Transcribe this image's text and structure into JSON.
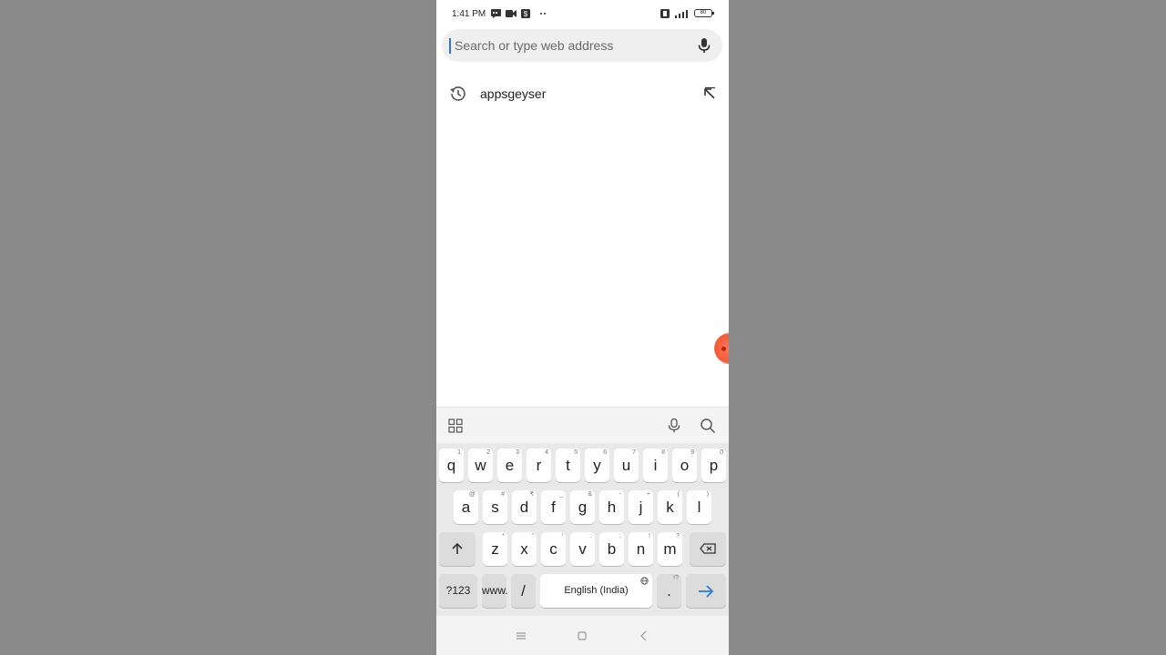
{
  "status_bar": {
    "time": "1:41 PM",
    "left_icons": [
      "message-icon",
      "video-icon",
      "app-icon",
      "more-dots-icon"
    ],
    "right_icons": [
      "vibrate-icon",
      "signal-icon"
    ],
    "battery": "80"
  },
  "search": {
    "placeholder": "Search or type web address",
    "voice_icon": "microphone-icon"
  },
  "suggestions": [
    {
      "text": "appsgeyser",
      "icon": "history-icon",
      "action_icon": "fill-arrow-icon"
    }
  ],
  "keyboard_toolbar": {
    "icons": [
      "grid-icon",
      "microphone-icon",
      "search-icon"
    ]
  },
  "keyboard": {
    "row1": [
      {
        "label": "q",
        "hint": "1"
      },
      {
        "label": "w",
        "hint": "2"
      },
      {
        "label": "e",
        "hint": "3"
      },
      {
        "label": "r",
        "hint": "4"
      },
      {
        "label": "t",
        "hint": "5"
      },
      {
        "label": "y",
        "hint": "6"
      },
      {
        "label": "u",
        "hint": "7"
      },
      {
        "label": "i",
        "hint": "8"
      },
      {
        "label": "o",
        "hint": "9"
      },
      {
        "label": "p",
        "hint": "0"
      }
    ],
    "row2": [
      {
        "label": "a",
        "hint": "@"
      },
      {
        "label": "s",
        "hint": "#"
      },
      {
        "label": "d",
        "hint": "₹"
      },
      {
        "label": "f",
        "hint": "_"
      },
      {
        "label": "g",
        "hint": "&"
      },
      {
        "label": "h",
        "hint": "-"
      },
      {
        "label": "j",
        "hint": "+"
      },
      {
        "label": "k",
        "hint": "("
      },
      {
        "label": "l",
        "hint": ")"
      }
    ],
    "row3": [
      {
        "label": "z",
        "hint": "*"
      },
      {
        "label": "x",
        "hint": "\""
      },
      {
        "label": "c",
        "hint": "'"
      },
      {
        "label": "v",
        "hint": ":"
      },
      {
        "label": "b",
        "hint": ";"
      },
      {
        "label": "n",
        "hint": "!"
      },
      {
        "label": "m",
        "hint": "?"
      }
    ],
    "symbols_key": "?123",
    "www_key": "www.",
    "slash_key": "/",
    "space_label": "English (India)",
    "period_key": ".",
    "period_hint": "!?"
  }
}
